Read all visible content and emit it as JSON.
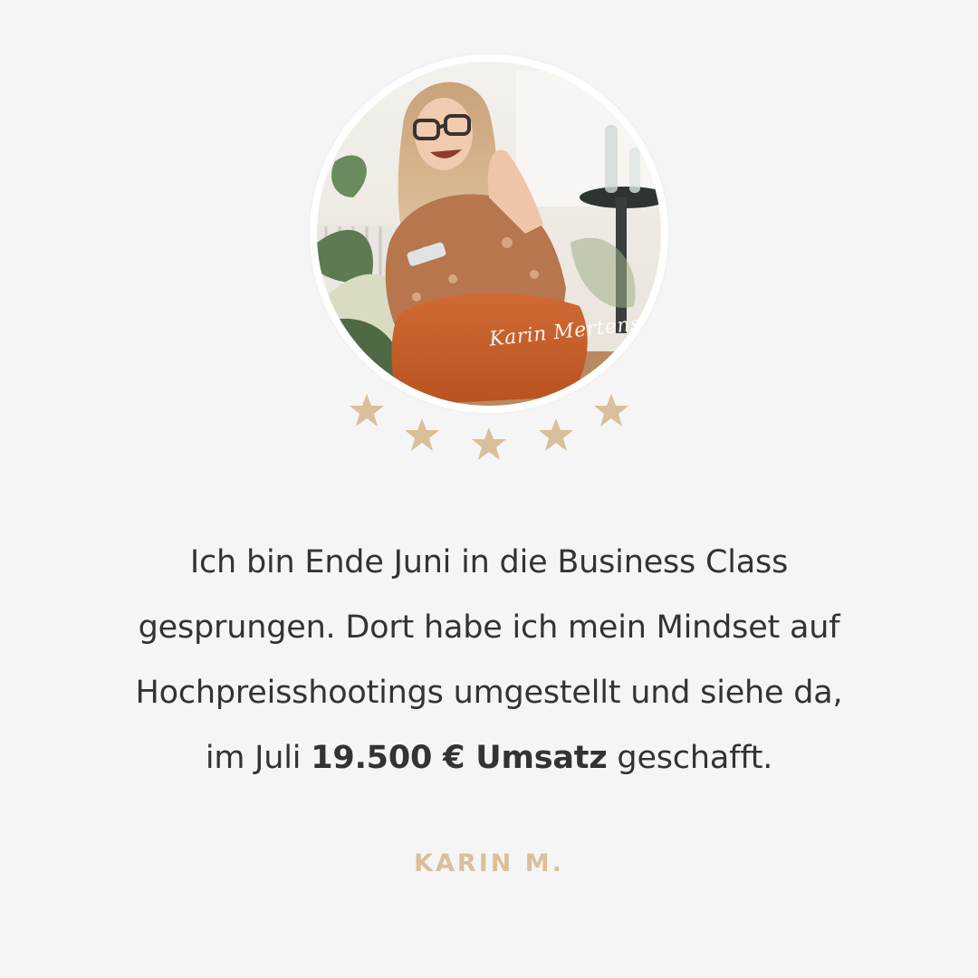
{
  "colors": {
    "background": "#f6f5f5",
    "text": "#333333",
    "accent": "#d9bf9b"
  },
  "photo": {
    "signature": "Karin Mertens"
  },
  "rating": {
    "stars": 5,
    "max": 5,
    "icon": "star-icon"
  },
  "testimonial": {
    "line1": "Ich bin Ende Juni in die Business Class",
    "line2": "gesprungen. Dort habe ich mein Mindset auf",
    "line3": "Hochpreisshootings umgestellt und siehe da,",
    "line4_before": "im Juli ",
    "line4_bold": "19.500 € Umsatz",
    "line4_after": " geschafft.",
    "author": "KARIN M."
  }
}
